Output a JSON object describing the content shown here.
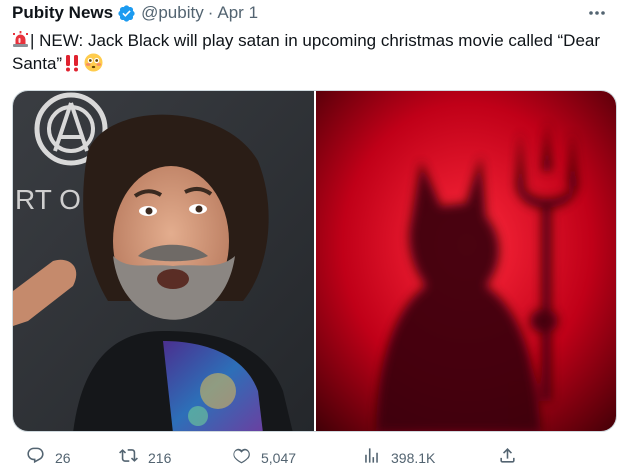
{
  "tweet": {
    "author_name": "Pubity News",
    "handle": "@pubity",
    "separator": "·",
    "timestamp": "Apr 1",
    "text_main": "| NEW: Jack Black will play satan in upcoming christmas movie called “Dear Santa”",
    "images": {
      "left_backdrop_text": "RT O"
    },
    "stats": {
      "replies": "26",
      "reposts": "216",
      "likes": "5,047",
      "views": "398.1K"
    }
  },
  "icons": {
    "verified": "verified-badge-icon",
    "more": "more-dots-icon",
    "siren": "rotating-light-emoji",
    "bangs": "double-exclamation-emoji",
    "flushed": "flushed-face-emoji",
    "reply": "reply-icon",
    "repost": "repost-icon",
    "like": "heart-icon",
    "views": "views-bar-chart-icon",
    "share": "share-icon"
  },
  "colors": {
    "text_primary": "#0f1419",
    "text_secondary": "#536471",
    "verified_blue": "#1d9bf0",
    "exclamation_red": "#e0222f",
    "devil_glow": "#e0102a"
  }
}
